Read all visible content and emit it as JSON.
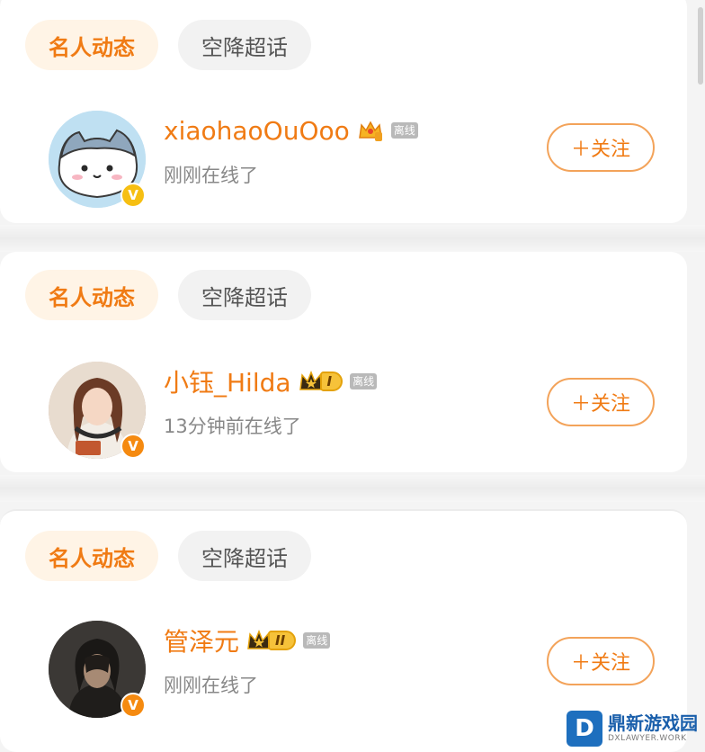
{
  "cards": [
    {
      "tabs": [
        {
          "label": "名人动态",
          "active": true
        },
        {
          "label": "空降超话",
          "active": false
        }
      ],
      "user": {
        "name": "xiaohaoOuOoo",
        "status_badge": "离线",
        "subtext": "刚刚在线了",
        "follow_label": "＋关注",
        "avatar_icon": "cat-cartoon-avatar",
        "verified_icon": "verified-yellow-v-icon",
        "verified_mark": "V",
        "badge_icon": "crown-icon"
      }
    },
    {
      "tabs": [
        {
          "label": "名人动态",
          "active": true
        },
        {
          "label": "空降超话",
          "active": false
        }
      ],
      "user": {
        "name": "小钰_Hilda",
        "vip_level": "I",
        "status_badge": "离线",
        "subtext": "13分钟前在线了",
        "follow_label": "＋关注",
        "avatar_icon": "woman-photo-avatar",
        "verified_icon": "verified-orange-v-icon",
        "verified_mark": "V",
        "badge_icon": "crown-vip-icon"
      }
    },
    {
      "tabs": [
        {
          "label": "名人动态",
          "active": true
        },
        {
          "label": "空降超话",
          "active": false
        }
      ],
      "user": {
        "name": "管泽元",
        "vip_level": "II",
        "status_badge": "离线",
        "subtext": "刚刚在线了",
        "follow_label": "＋关注",
        "avatar_icon": "man-photo-avatar",
        "verified_icon": "verified-orange-v-icon",
        "verified_mark": "V",
        "badge_icon": "crown-vip-icon"
      }
    }
  ],
  "watermark": {
    "logo_letter": "D",
    "title": "鼎新游戏园",
    "subtitle": "DXLAWYER.WORK"
  },
  "colors": {
    "accent": "#f07b14",
    "tab_active_bg": "#fff4e6",
    "tab_inactive_bg": "#f2f2f2",
    "verified_yellow": "#f6bf12",
    "verified_orange": "#f58a10",
    "offline_badge": "#b9b9b9"
  }
}
